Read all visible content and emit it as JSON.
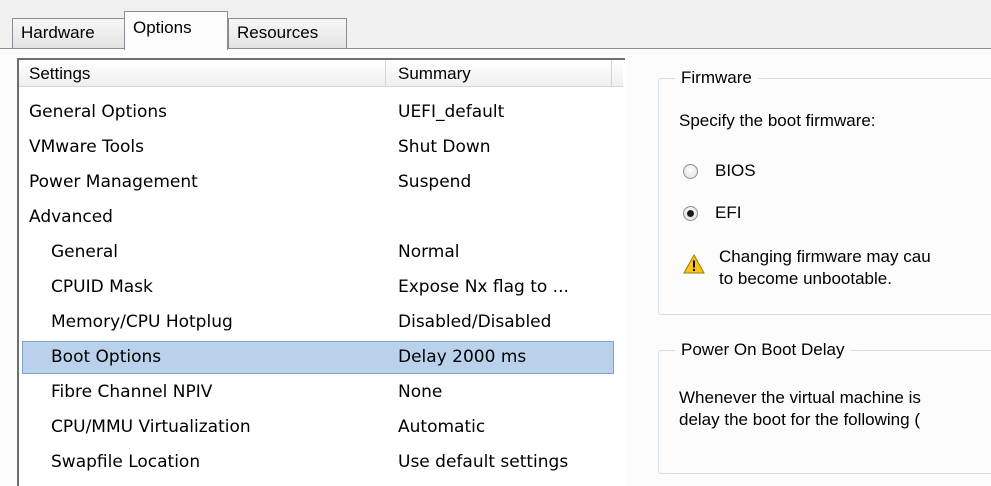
{
  "tabs": [
    {
      "label": "Hardware",
      "active": false
    },
    {
      "label": "Options",
      "active": true
    },
    {
      "label": "Resources",
      "active": false
    }
  ],
  "settings_list": {
    "columns": [
      "Settings",
      "Summary"
    ],
    "rows": [
      {
        "setting": "General Options",
        "summary": "UEFI_default"
      },
      {
        "setting": "VMware Tools",
        "summary": "Shut Down"
      },
      {
        "setting": "Power Management",
        "summary": "Suspend"
      },
      {
        "setting": "Advanced",
        "summary": ""
      },
      {
        "setting": "General",
        "summary": "Normal"
      },
      {
        "setting": "CPUID Mask",
        "summary": "Expose Nx flag to ..."
      },
      {
        "setting": "Memory/CPU Hotplug",
        "summary": "Disabled/Disabled"
      },
      {
        "setting": "Boot Options",
        "summary": "Delay 2000 ms",
        "selected": true
      },
      {
        "setting": "Fibre Channel NPIV",
        "summary": "None"
      },
      {
        "setting": "CPU/MMU Virtualization",
        "summary": "Automatic"
      },
      {
        "setting": "Swapfile Location",
        "summary": "Use default settings"
      }
    ]
  },
  "firmware": {
    "legend": "Firmware",
    "prompt": "Specify the boot firmware:",
    "options": [
      {
        "label": "BIOS",
        "checked": false
      },
      {
        "label": "EFI",
        "checked": true
      }
    ],
    "warning_line1": "Changing firmware may cau",
    "warning_line2": "to become unbootable."
  },
  "boot_delay": {
    "legend": "Power On Boot Delay",
    "text_line1": "Whenever the virtual machine is",
    "text_line2": "delay the boot for the following ("
  },
  "colors": {
    "selection_fill": "#b9d1ea",
    "selection_border": "#7da2ce",
    "warning_yellow": "#f5c518"
  }
}
